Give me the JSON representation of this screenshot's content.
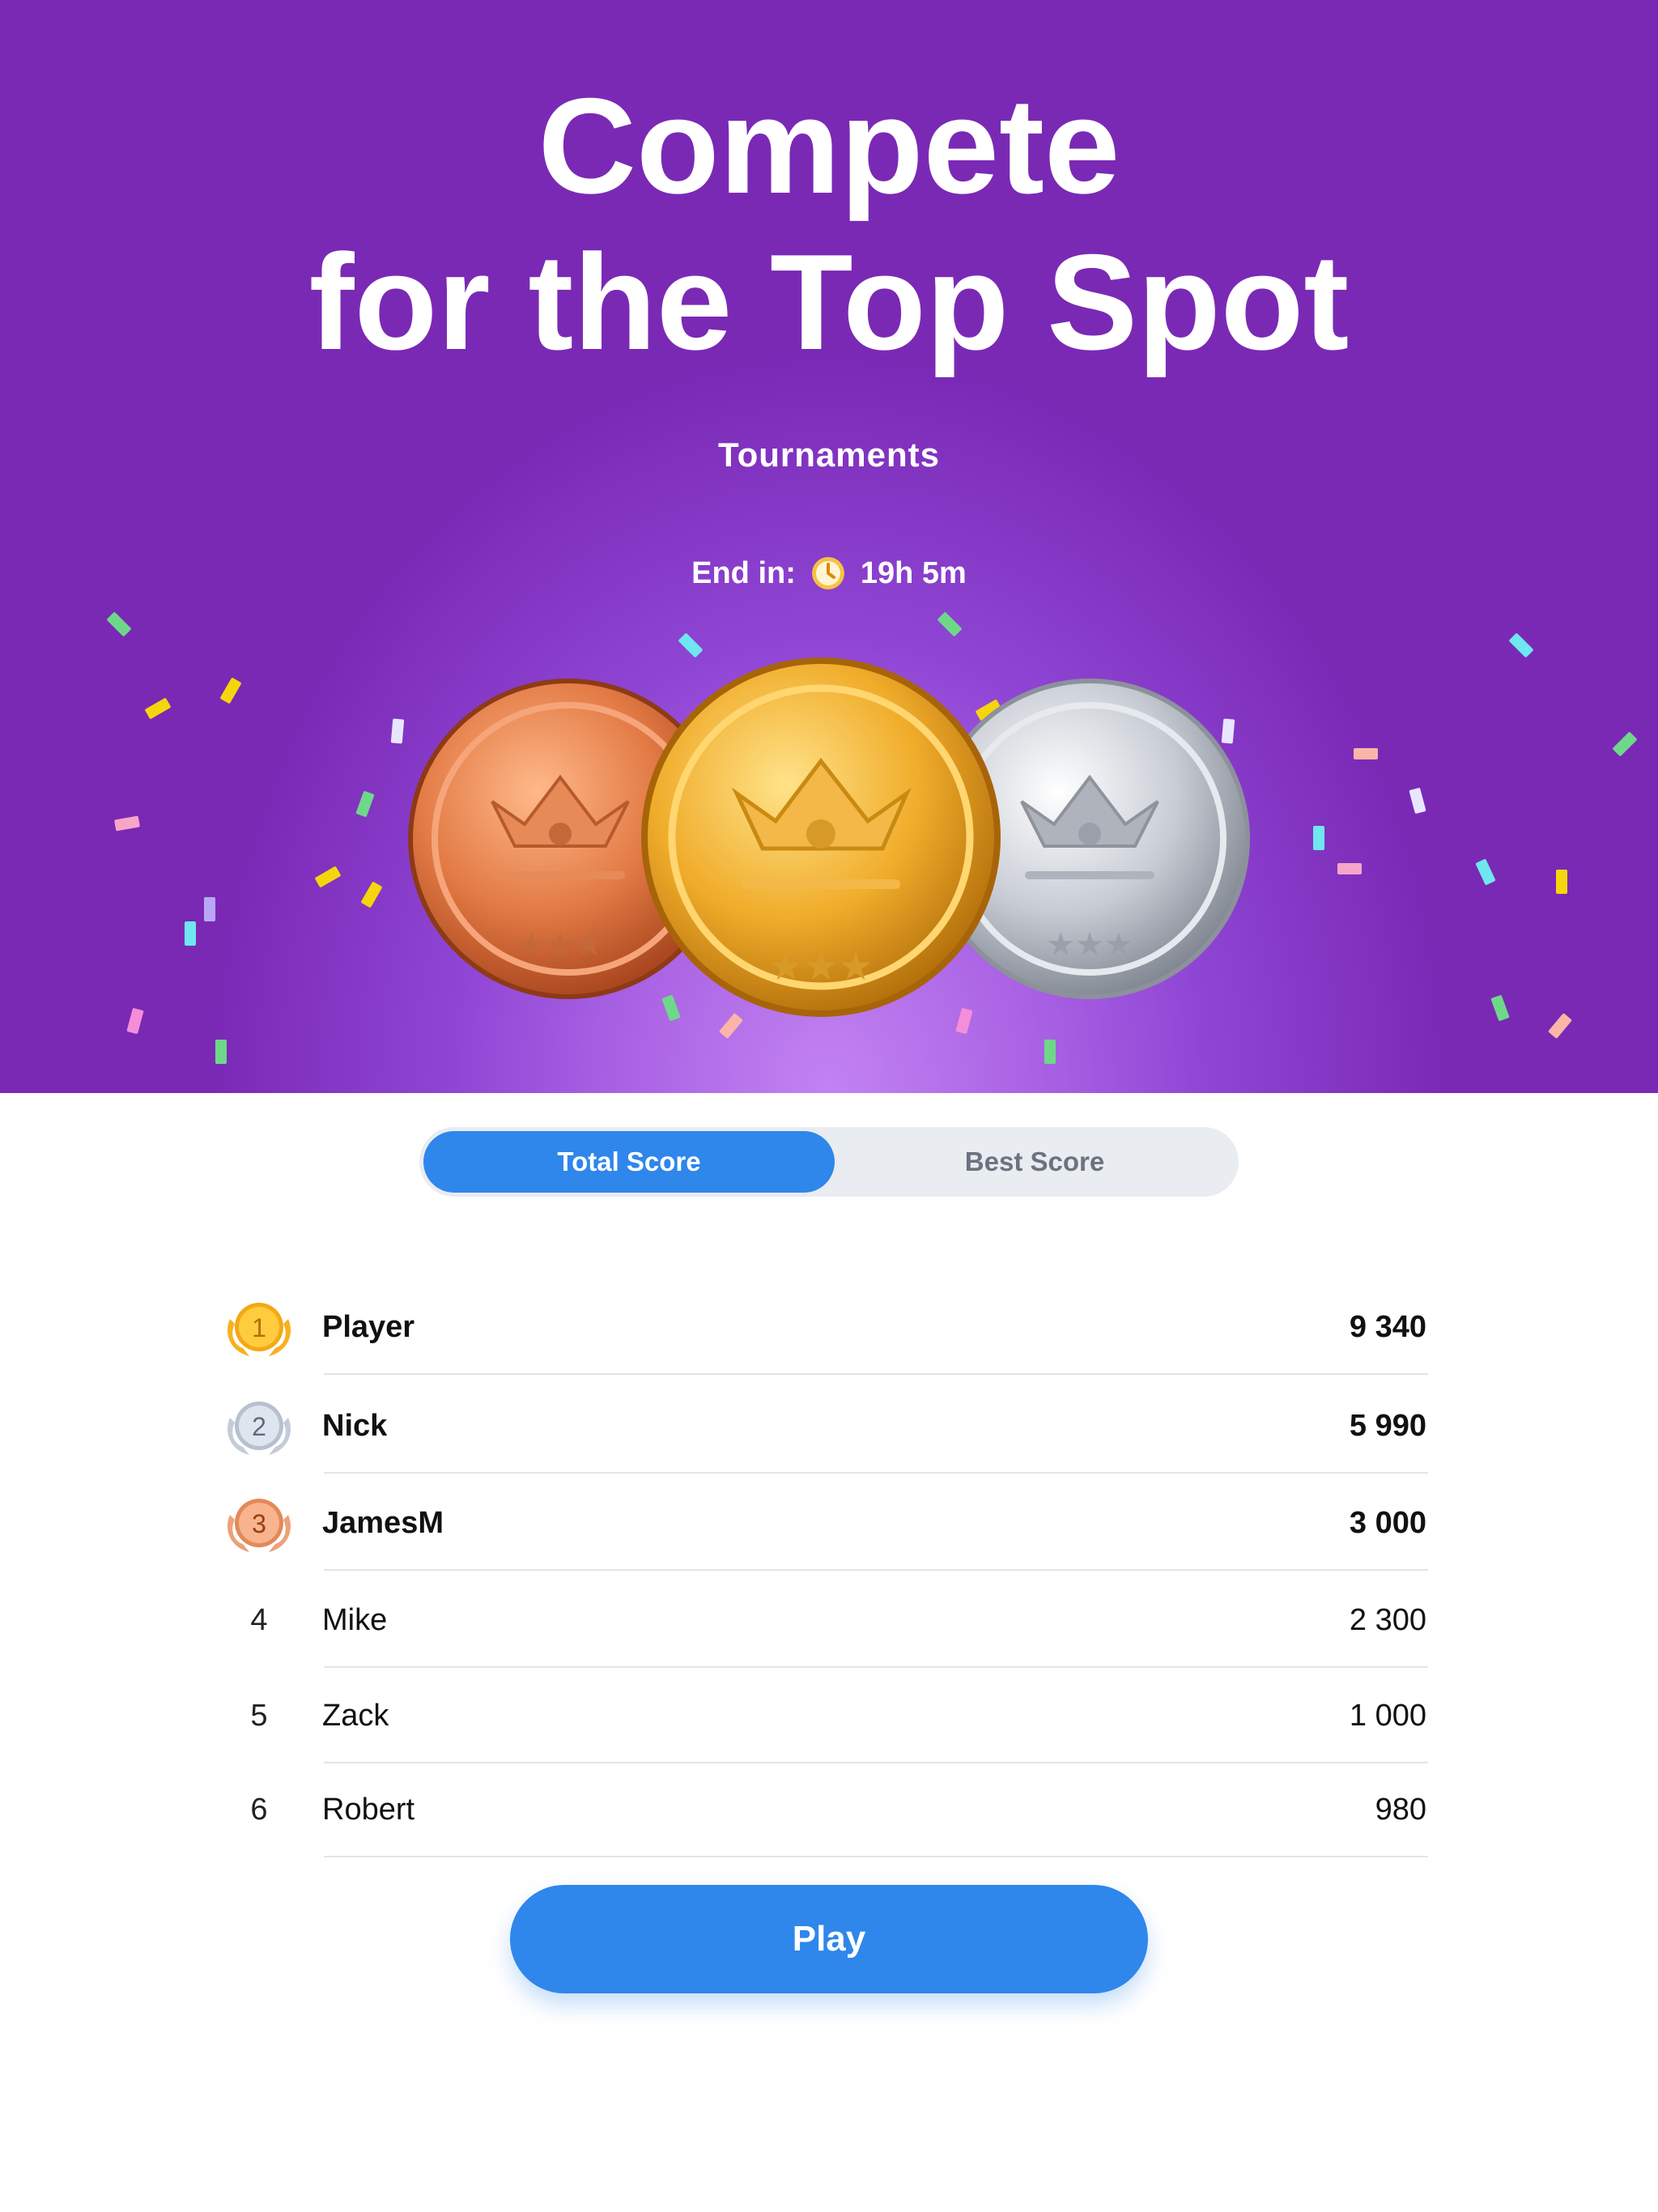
{
  "hero": {
    "title_line1": "Compete",
    "title_line2": "for the Top Spot",
    "subtitle": "Tournaments",
    "timer_label": "End in:",
    "timer_value": "19h 5m",
    "timer_icon": "clock-icon",
    "medals": [
      "bronze-medal",
      "gold-medal",
      "silver-medal"
    ]
  },
  "tabs": {
    "active_label": "Total Score",
    "inactive_label": "Best Score"
  },
  "leaderboard": [
    {
      "rank": "1",
      "name": "Player",
      "score": "9 340",
      "badge": "gold-badge"
    },
    {
      "rank": "2",
      "name": "Nick",
      "score": "5 990",
      "badge": "silver-badge"
    },
    {
      "rank": "3",
      "name": "JamesM",
      "score": "3 000",
      "badge": "bronze-badge"
    },
    {
      "rank": "4",
      "name": "Mike",
      "score": "2 300"
    },
    {
      "rank": "5",
      "name": "Zack",
      "score": "1 000"
    },
    {
      "rank": "6",
      "name": "Robert",
      "score": "980"
    }
  ],
  "play_label": "Play",
  "colors": {
    "hero_purple": "#7a29b5",
    "accent_blue": "#2f86eb",
    "gold": "#f3b21a",
    "silver": "#c9d1de",
    "bronze": "#e38b5b"
  }
}
